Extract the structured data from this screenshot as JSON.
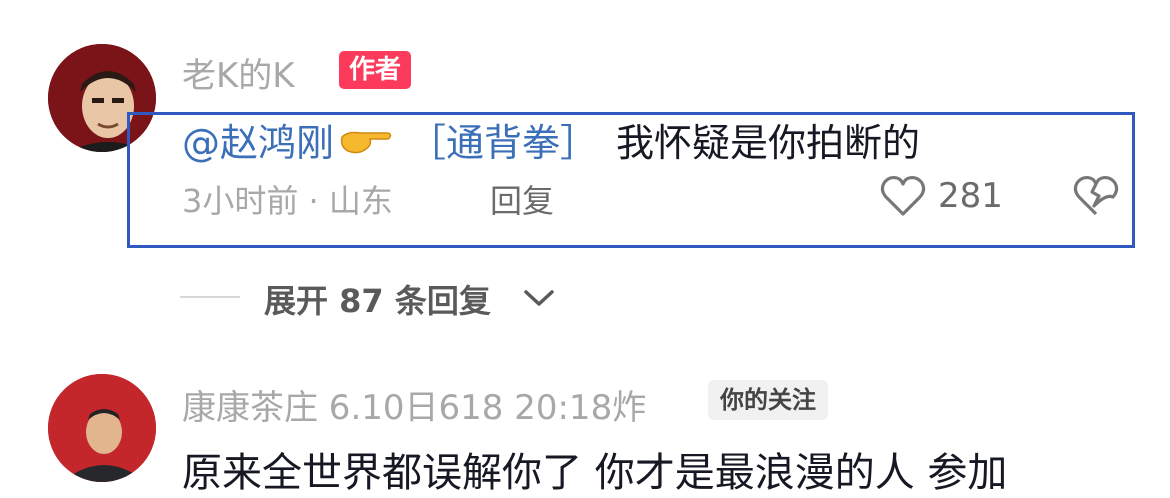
{
  "comment1": {
    "username": "老K的K",
    "badge": "作者",
    "mention": "@赵鸿刚",
    "emoji": "point-right-emoji",
    "hashtag": "［通背拳］",
    "text": "我怀疑是你拍断的",
    "meta": "3小时前 · 山东",
    "reply_label": "回复",
    "like_count": "281"
  },
  "expand": {
    "label": "展开 87 条回复"
  },
  "comment2": {
    "username": "康康茶庄 6.10日618 20:18炸",
    "badge": "你的关注",
    "text": "原来全世界都误解你了 你才是最浪漫的人 参加"
  },
  "colors": {
    "accent": "#fc3a5c",
    "link": "#3b6fb8",
    "highlight": "#2f58c0"
  }
}
